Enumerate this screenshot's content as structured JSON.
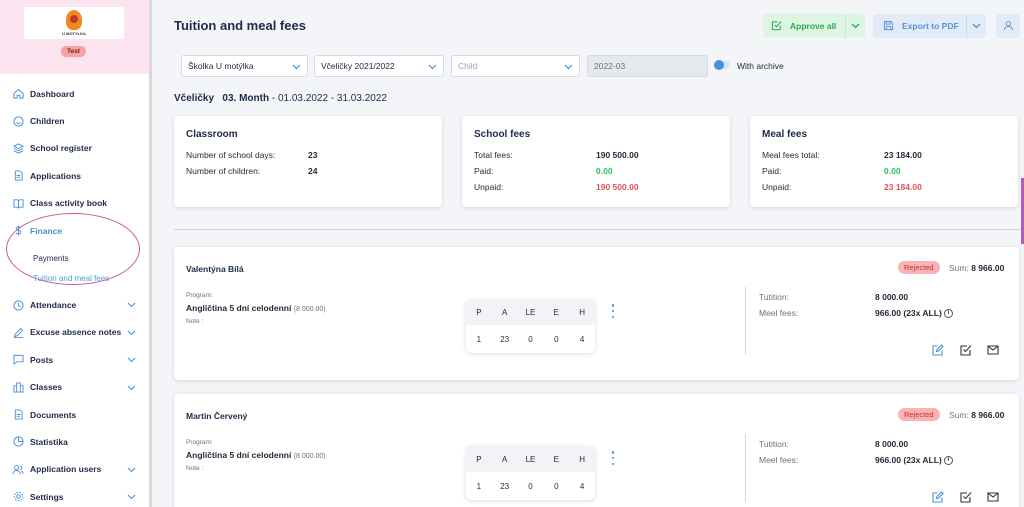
{
  "sidebar": {
    "logo_text": "U MOTÝLKA",
    "badge": "Test",
    "items": [
      {
        "label": "Dashboard",
        "icon": "home-icon"
      },
      {
        "label": "Children",
        "icon": "smile-icon"
      },
      {
        "label": "School register",
        "icon": "layers-icon"
      },
      {
        "label": "Applications",
        "icon": "document-icon"
      },
      {
        "label": "Class activity book",
        "icon": "book-icon"
      },
      {
        "label": "Finance",
        "icon": "dollar-icon"
      },
      {
        "label": "Attendance",
        "icon": "clock-icon"
      },
      {
        "label": "Excuse absence notes",
        "icon": "pencil-icon"
      },
      {
        "label": "Posts",
        "icon": "chat-icon"
      },
      {
        "label": "Classes",
        "icon": "building-icon"
      },
      {
        "label": "Documents",
        "icon": "document-icon"
      },
      {
        "label": "Statistika",
        "icon": "pie-icon"
      },
      {
        "label": "Application users",
        "icon": "users-icon"
      },
      {
        "label": "Settings",
        "icon": "gear-icon"
      }
    ],
    "finance_sub": [
      "Payments",
      "Tuition and meal fees"
    ]
  },
  "header": {
    "title": "Tuition and meal fees",
    "approve_label": "Approve all",
    "export_label": "Export to PDF"
  },
  "filters": {
    "school": "Školka U motýlka",
    "class": "Včeličky 2021/2022",
    "child_placeholder": "Child",
    "month": "2022-03",
    "archive_label": "With archive"
  },
  "period": {
    "class_name": "Včeličky",
    "month": "03. Month",
    "range": "- 01.03.2022 - 31.03.2022"
  },
  "summary": {
    "classroom": {
      "title": "Classroom",
      "days_label": "Number of school days:",
      "days_value": "23",
      "children_label": "Number of children:",
      "children_value": "24"
    },
    "school_fees": {
      "title": "School fees",
      "total_label": "Total fees:",
      "total_value": "190 500.00",
      "paid_label": "Paid:",
      "paid_value": "0.00",
      "unpaid_label": "Unpaid:",
      "unpaid_value": "190 500.00"
    },
    "meal_fees": {
      "title": "Meal fees",
      "total_label": "Meal fees total:",
      "total_value": "23 184.00",
      "paid_label": "Paid:",
      "paid_value": "0.00",
      "unpaid_label": "Unpaid:",
      "unpaid_value": "23 184.00"
    }
  },
  "children": [
    {
      "name": "Valentýna Bílá",
      "status": "Rejected",
      "sum_label": "Sum:",
      "sum_value": "8 966.00",
      "program_label": "Program:",
      "program": "Angličtina 5 dní celodenní",
      "program_price": "(8 000.00)",
      "note_label": "Note :",
      "att_headers": [
        "P",
        "A",
        "LE",
        "E",
        "H"
      ],
      "att_values": [
        "1",
        "23",
        "0",
        "0",
        "4"
      ],
      "tuition_label": "Tutition:",
      "tuition_value": "8 000.00",
      "meal_label": "Meel fees:",
      "meal_value": "966.00 (23x ALL)"
    },
    {
      "name": "Martin Červený",
      "status": "Rejected",
      "sum_label": "Sum:",
      "sum_value": "8 966.00",
      "program_label": "Program:",
      "program": "Angličtina 5 dní celodenní",
      "program_price": "(8 000.00)",
      "note_label": "Note :",
      "att_headers": [
        "P",
        "A",
        "LE",
        "E",
        "H"
      ],
      "att_values": [
        "1",
        "23",
        "0",
        "0",
        "4"
      ],
      "tuition_label": "Tutition:",
      "tuition_value": "8 000.00",
      "meal_label": "Meel fees:",
      "meal_value": "966.00 (23x ALL)"
    }
  ],
  "colors": {
    "accent": "#4a90d9",
    "approve": "#2ea84e",
    "rejected": "#f8b4b4",
    "sidebar_header": "#fbe3ef"
  }
}
